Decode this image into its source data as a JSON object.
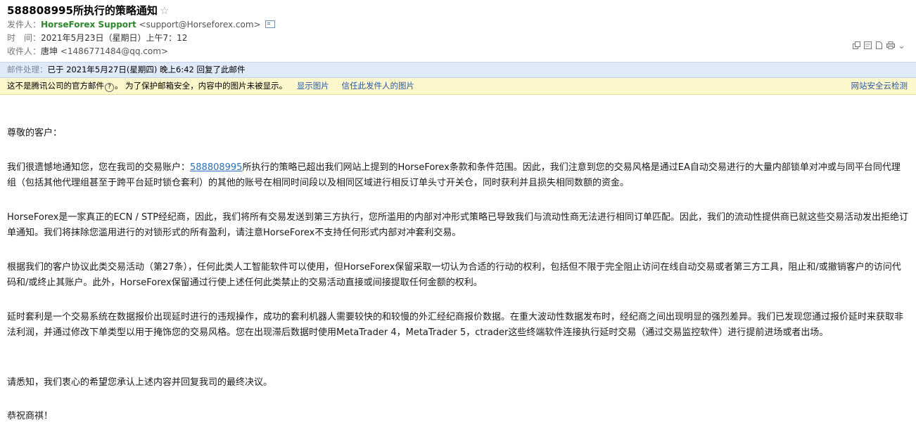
{
  "email": {
    "subject": "588808995所执行的策略通知",
    "star_icon": "☆",
    "from_label": "发件人：",
    "from_name": "HorseForex Support",
    "from_addr": "<support@Horseforex.com>",
    "time_label": "时　间：",
    "time_value": "2021年5月23日（星期日）上午7：12",
    "to_label": "收件人：",
    "to_name": "唐坤",
    "to_addr": "<1486771484@qq.com>"
  },
  "toolbar": {
    "icons": [
      "new-window-icon",
      "preview-icon",
      "document-icon",
      "print-icon",
      "expand-icon"
    ],
    "expand_glyph": "⌄"
  },
  "reply_bar": {
    "label": "邮件处理：",
    "text": "已于 2021年5月27日(星期四) 晚上6:42 回复了此邮件"
  },
  "warn_bar": {
    "text1": "这不是腾讯公司的官方邮件",
    "qmark": "?",
    "text2": "。 为了保护邮箱安全，内容中的图片未被显示。",
    "show_images": "显示图片",
    "trust_sender": "信任此发件人的图片",
    "security_check": "网站安全云检测"
  },
  "body": {
    "greeting": "尊敬的客户：",
    "p1_before": "我们很遗憾地通知您，您在我司的交易账户：",
    "account": "588808995",
    "p1_after": "所执行的策略已超出我们网站上提到的HorseForex条款和条件范围。因此，我们注意到您的交易风格是通过EA自动交易进行的大量内部锁单对冲或与同平台同代理组（包括其他代理组甚至于跨平台延时锁仓套利）的其他的账号在相同时间段以及相同区域进行相反订单头寸开关仓，同时获利并且损失相同数额的资金。",
    "p2": "HorseForex是一家真正的ECN / STP经纪商，因此，我们将所有交易发送到第三方执行，您所滥用的内部对冲形式策略已导致我们与流动性商无法进行相同订单匹配。因此，我们的流动性提供商已就这些交易活动发出拒绝订单通知。我们将抹除您滥用进行的对锁形式的所有盈利，请注意HorseForex不支持任何形式内部对冲套利交易。",
    "p3": "根据我们的客户协议此类交易活动（第27条），任何此类人工智能软件可以使用，但HorseForex保留采取一切认为合适的行动的权利，包括但不限于完全阻止访问在线自动交易或者第三方工具，阻止和/或撤销客户的访问代码和/或终止其账户。此外，HorseForex保留通过行使上述任何此类禁止的交易活动直接或间接提取任何金额的权利。",
    "p4": "延时套利是一个交易系统在数据报价出现延时进行的违规操作，成功的套利机器人需要较快的和较慢的外汇经纪商报价数据。在重大波动性数据发布时，经纪商之间出现明显的强烈差异。我们已发现您通过报价延时来获取非法利润，并通过修改下单类型以用于掩饰您的交易风格。您在出现滞后数据时使用MetaTrader 4，MetaTrader 5，ctrader这些终端软件连接执行延时交易（通过交易监控软件）进行提前进场或者出场。",
    "p5": "请悉知，我们衷心的希望您承认上述内容并回复我司的最终决议。",
    "closing": "恭祝商祺！"
  }
}
